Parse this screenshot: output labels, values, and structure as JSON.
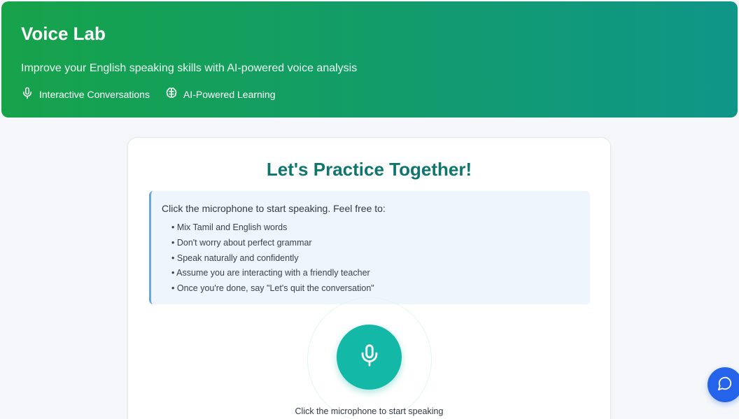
{
  "hero": {
    "title": "Voice Lab",
    "subtitle": "Improve your English speaking skills with AI-powered voice analysis",
    "features": [
      {
        "icon": "microphone-icon",
        "label": "Interactive Conversations"
      },
      {
        "icon": "brain-icon",
        "label": "AI-Powered Learning"
      }
    ],
    "gradient_start": "#16a34a",
    "gradient_end": "#0f9688"
  },
  "practice": {
    "title": "Let's Practice Together!",
    "instructions_lead": "Click the microphone to start speaking. Feel free to:",
    "tips": [
      "Mix Tamil and English words",
      "Don't worry about perfect grammar",
      "Speak naturally and confidently",
      "Assume you are interacting with a friendly teacher",
      "Once you're done, say \"Let's quit the conversation\""
    ],
    "mic_caption": "Click the microphone to start speaking",
    "mic_color": "#14b8a6",
    "title_color": "#0f766e"
  },
  "chat_widget": {
    "icon": "chat-bubble-icon",
    "color": "#2563eb"
  }
}
